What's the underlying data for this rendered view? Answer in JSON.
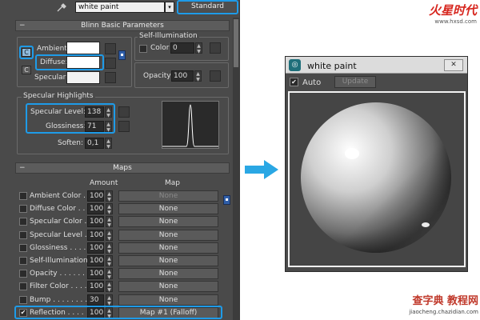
{
  "material": {
    "name": "white paint",
    "type_button": "Standard"
  },
  "blinn": {
    "title": "Blinn Basic Parameters",
    "ambient_label": "Ambient:",
    "diffuse_label": "Diffuse:",
    "specular_label": "Specular:",
    "self_illum_title": "Self-Illumination",
    "color_label": "Color",
    "color_value": "0",
    "opacity_label": "Opacity:",
    "opacity_value": "100",
    "lock_glyph": "C"
  },
  "highlights": {
    "title": "Specular Highlights",
    "specular_level_label": "Specular Level:",
    "specular_level_value": "138",
    "glossiness_label": "Glossiness:",
    "glossiness_value": "71",
    "soften_label": "Soften:",
    "soften_value": "0,1"
  },
  "maps": {
    "title": "Maps",
    "amount_header": "Amount",
    "map_header": "Map",
    "rows": [
      {
        "label": "Ambient Color . .",
        "amount": "100",
        "map": "None",
        "checked": false,
        "disabled": true
      },
      {
        "label": "Diffuse Color . . .",
        "amount": "100",
        "map": "None",
        "checked": false,
        "disabled": false
      },
      {
        "label": "Specular Color . .",
        "amount": "100",
        "map": "None",
        "checked": false,
        "disabled": false
      },
      {
        "label": "Specular Level . .",
        "amount": "100",
        "map": "None",
        "checked": false,
        "disabled": false
      },
      {
        "label": "Glossiness . . . . .",
        "amount": "100",
        "map": "None",
        "checked": false,
        "disabled": false
      },
      {
        "label": "Self-Illumination . .",
        "amount": "100",
        "map": "None",
        "checked": false,
        "disabled": false
      },
      {
        "label": "Opacity . . . . . . .",
        "amount": "100",
        "map": "None",
        "checked": false,
        "disabled": false
      },
      {
        "label": "Filter Color . . . .",
        "amount": "100",
        "map": "None",
        "checked": false,
        "disabled": false
      },
      {
        "label": "Bump . . . . . . . .",
        "amount": "30",
        "map": "None",
        "checked": false,
        "disabled": false
      },
      {
        "label": "Reflection . . . .",
        "amount": "100",
        "map": "Map #1 (Falloff)",
        "checked": true,
        "disabled": false
      }
    ],
    "check_glyph": "✔"
  },
  "preview": {
    "title": "white paint",
    "auto_label": "Auto",
    "update_button": "Update",
    "close_glyph": "✕"
  },
  "watermarks": {
    "top_logo": "火星时代",
    "top_url": "www.hxsd.com",
    "bottom_logo": "查字典 教程网",
    "bottom_url": "jiaocheng.chazidian.com"
  },
  "colors": {
    "highlight": "#1e9be8",
    "arrow": "#2aa7e4",
    "panel_bg": "#4a4a4a"
  }
}
